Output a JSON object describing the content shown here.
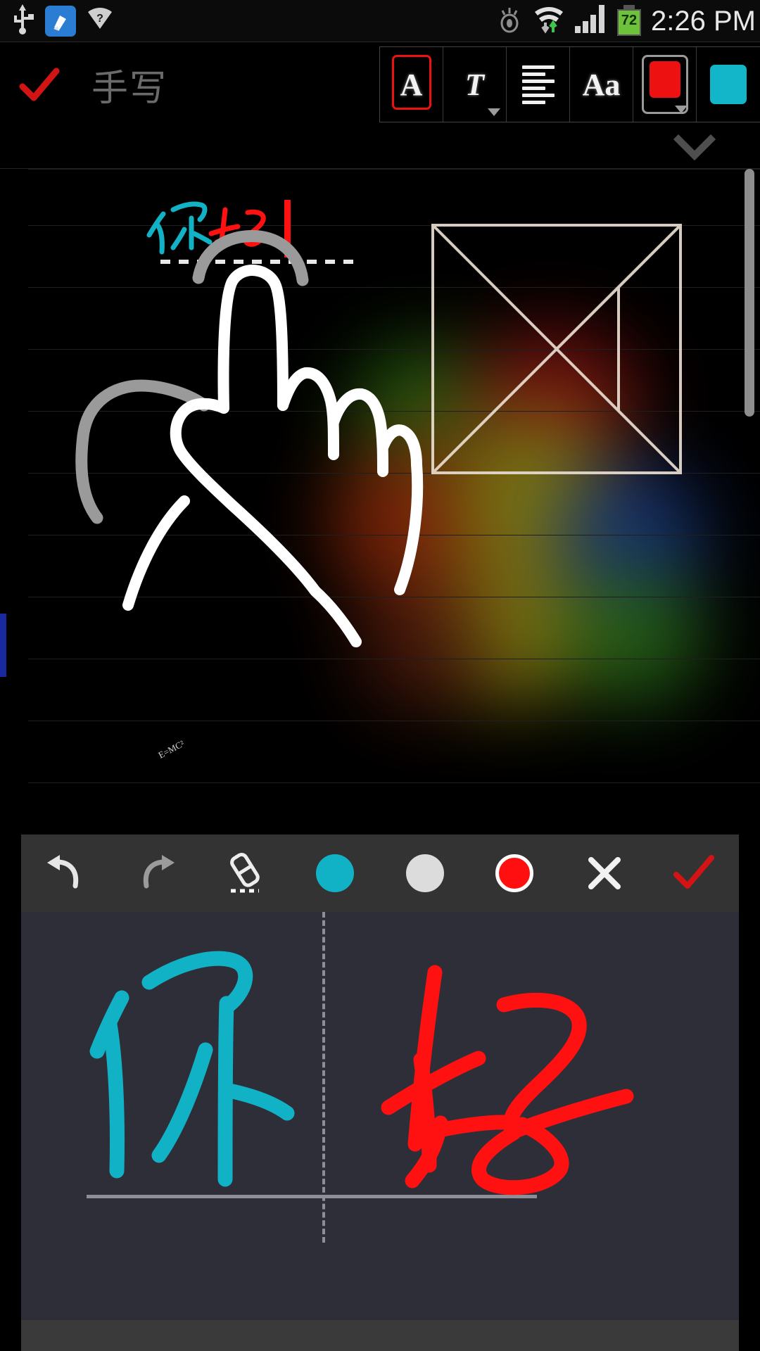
{
  "status_bar": {
    "icons_left": [
      "usb-icon",
      "cleaner-app-icon",
      "wifi-question-icon"
    ],
    "icons_right": [
      "eye-icon",
      "wifi-transfer-icon",
      "signal-bars-icon"
    ],
    "battery_level": "72",
    "time": "2:26 PM"
  },
  "app_toolbar": {
    "confirm_icon": "check-icon",
    "title": "手写",
    "buttons": [
      {
        "name": "text-style-button",
        "glyph": "A",
        "selected": true,
        "has_caret": false
      },
      {
        "name": "text-format-button",
        "glyph": "T",
        "selected": false,
        "has_caret": true
      },
      {
        "name": "align-button",
        "glyph": "",
        "selected": false,
        "has_caret": false
      },
      {
        "name": "font-size-button",
        "glyph": "Aa",
        "selected": false,
        "has_caret": false
      },
      {
        "name": "text-color-button",
        "glyph": "",
        "selected": false,
        "has_caret": true,
        "color": "#ee1111"
      },
      {
        "name": "highlight-color-button",
        "glyph": "",
        "selected": false,
        "has_caret": false,
        "color": "#13b5c9"
      }
    ],
    "collapse_icon": "chevron-down-icon"
  },
  "canvas": {
    "typed_text_cyan": "你",
    "typed_text_red": "好",
    "cursor": "text-cursor",
    "sketch_label": "E=MC²",
    "shape_name": "tangram-square-sketch",
    "hand_sketch_name": "hand-pointing-sketch",
    "scrollbar": "vertical-scrollbar",
    "colors": {
      "cyan": "#12b2c6",
      "red": "#ff1111",
      "ink_white": "#ffffff",
      "ink_gray": "#9a9a9a",
      "rule_line": "#1f1f1f",
      "left_marker": "#1a2a9e"
    }
  },
  "handwrite_panel": {
    "toolbar": [
      {
        "name": "undo-button",
        "icon": "undo-icon"
      },
      {
        "name": "redo-button",
        "icon": "redo-icon"
      },
      {
        "name": "eraser-button",
        "icon": "eraser-icon"
      },
      {
        "name": "color-cyan-button",
        "icon": "color-dot-icon",
        "color": "#12b2c6",
        "selected": false
      },
      {
        "name": "color-white-button",
        "icon": "color-dot-icon",
        "color": "#dcdcdc",
        "selected": false
      },
      {
        "name": "color-red-button",
        "icon": "color-dot-icon",
        "color": "#ff0f0f",
        "selected": true
      },
      {
        "name": "cancel-button",
        "icon": "close-icon"
      },
      {
        "name": "confirm-button",
        "icon": "check-icon"
      }
    ],
    "stroke_left": "你",
    "stroke_right": "好",
    "left_color": "#12b2c6",
    "right_color": "#ff1111",
    "background": "#2e2e38",
    "divider": "dashed-cell-divider",
    "baseline": "writing-baseline"
  }
}
